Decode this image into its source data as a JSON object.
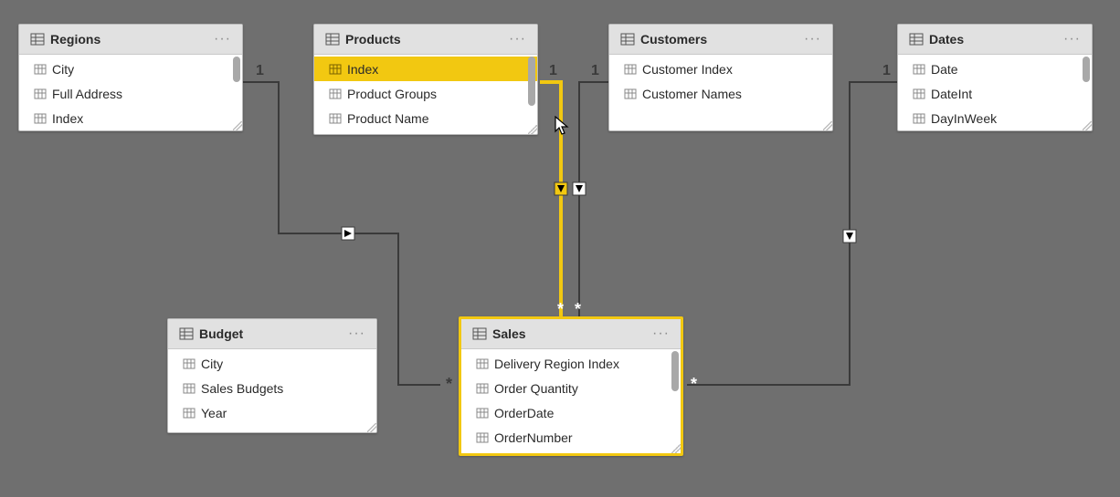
{
  "cardinality": {
    "one": "1",
    "many": "*"
  },
  "tables": {
    "regions": {
      "name": "Regions",
      "fields": [
        "City",
        "Full Address",
        "Index"
      ],
      "highlight_index": -1,
      "scroll": true
    },
    "products": {
      "name": "Products",
      "fields": [
        "Index",
        "Product Groups",
        "Product Name"
      ],
      "highlight_index": 0,
      "scroll": true
    },
    "customers": {
      "name": "Customers",
      "fields": [
        "Customer Index",
        "Customer Names"
      ],
      "highlight_index": -1,
      "scroll": false
    },
    "dates": {
      "name": "Dates",
      "fields": [
        "Date",
        "DateInt",
        "DayInWeek"
      ],
      "highlight_index": -1,
      "scroll": true
    },
    "budget": {
      "name": "Budget",
      "fields": [
        "City",
        "Sales Budgets",
        "Year"
      ],
      "highlight_index": -1,
      "scroll": false
    },
    "sales": {
      "name": "Sales",
      "fields": [
        "Delivery Region Index",
        "Order Quantity",
        "OrderDate",
        "OrderNumber"
      ],
      "highlight_index": -1,
      "scroll": true
    }
  },
  "relationships": [
    {
      "from": "regions",
      "from_card": "1",
      "to": "budget",
      "to_card": "*",
      "active": true
    },
    {
      "from": "products",
      "from_card": "1",
      "to": "sales",
      "to_card": "*",
      "active": true,
      "highlighted": true
    },
    {
      "from": "customers",
      "from_card": "1",
      "to": "sales",
      "to_card": "*",
      "active": true
    },
    {
      "from": "dates",
      "from_card": "1",
      "to": "sales",
      "to_card": "*",
      "active": true
    }
  ]
}
